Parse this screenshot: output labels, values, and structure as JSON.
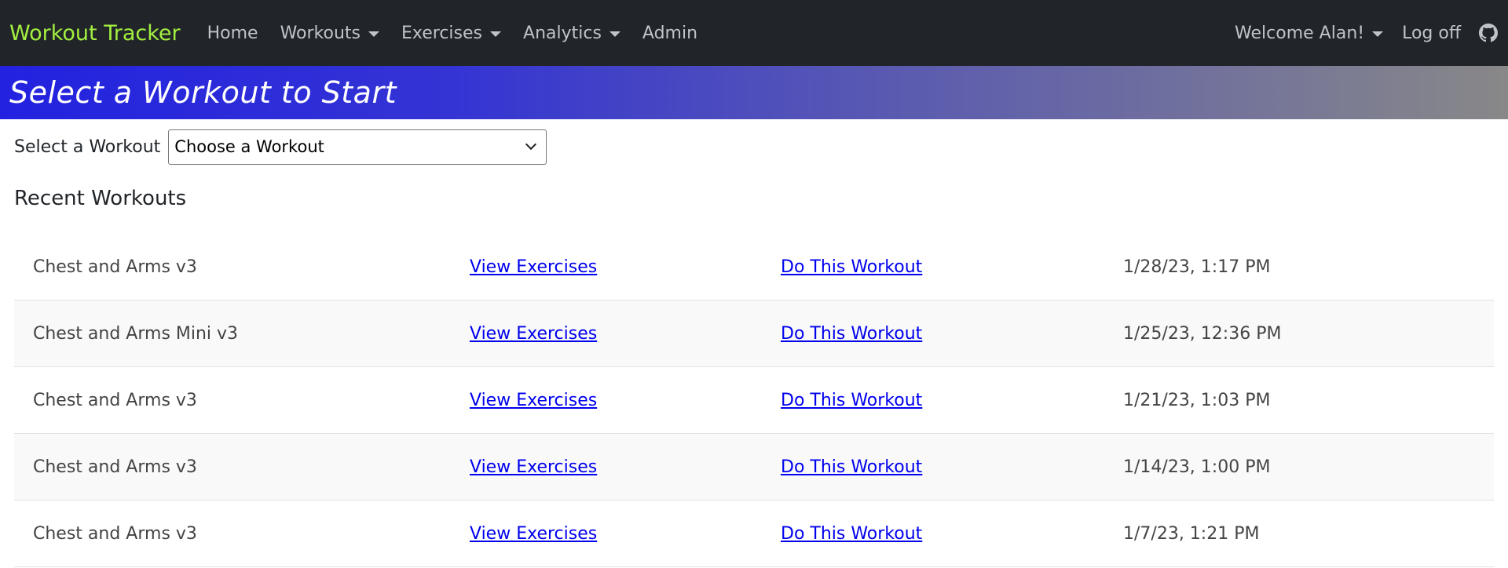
{
  "navbar": {
    "brand": "Workout Tracker",
    "items": [
      {
        "label": "Home",
        "dropdown": false
      },
      {
        "label": "Workouts",
        "dropdown": true
      },
      {
        "label": "Exercises",
        "dropdown": true
      },
      {
        "label": "Analytics",
        "dropdown": true
      },
      {
        "label": "Admin",
        "dropdown": false
      }
    ],
    "welcome": "Welcome Alan!",
    "logoff": "Log off",
    "github_icon": "github-icon"
  },
  "hero": {
    "title": "Select a Workout to Start"
  },
  "selector": {
    "label": "Select a Workout",
    "value": "Choose a Workout"
  },
  "recent": {
    "title": "Recent Workouts",
    "rows": [
      {
        "name": "Chest and Arms v3",
        "view": "View Exercises",
        "do": "Do This Workout",
        "date": "1/28/23, 1:17 PM"
      },
      {
        "name": "Chest and Arms Mini v3",
        "view": "View Exercises",
        "do": "Do This Workout",
        "date": "1/25/23, 12:36 PM"
      },
      {
        "name": "Chest and Arms v3",
        "view": "View Exercises",
        "do": "Do This Workout",
        "date": "1/21/23, 1:03 PM"
      },
      {
        "name": "Chest and Arms v3",
        "view": "View Exercises",
        "do": "Do This Workout",
        "date": "1/14/23, 1:00 PM"
      },
      {
        "name": "Chest and Arms v3",
        "view": "View Exercises",
        "do": "Do This Workout",
        "date": "1/7/23, 1:21 PM"
      }
    ]
  },
  "colors": {
    "navbar_bg": "#212529",
    "brand": "#a3f03f",
    "link": "#0000ee",
    "hero_gradient_start": "#2222e0",
    "hero_gradient_end": "#888888"
  }
}
